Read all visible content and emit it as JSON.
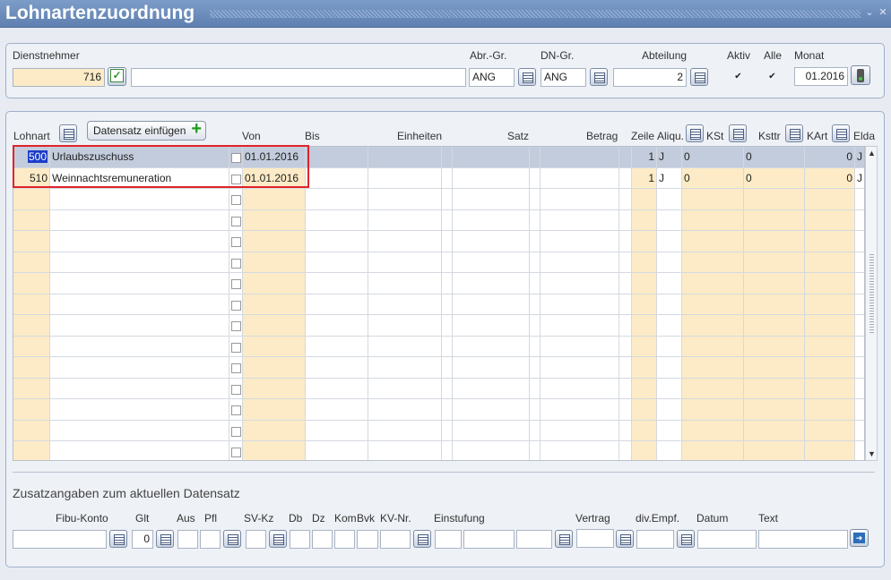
{
  "window": {
    "title": "Lohnartenzuordnung",
    "minimize_glyph": "⌄",
    "close_glyph": "✕"
  },
  "header": {
    "dienstnehmer_label": "Dienstnehmer",
    "dienstnehmer_value": "716",
    "dienstnehmer_name": "",
    "abr_gr_label": "Abr.-Gr.",
    "abr_gr_value": "ANG",
    "dn_gr_label": "DN-Gr.",
    "dn_gr_value": "ANG",
    "abteilung_label": "Abteilung",
    "abteilung_value": "2",
    "aktiv_label": "Aktiv",
    "aktiv_checked": true,
    "alle_label": "Alle",
    "alle_checked": true,
    "monat_label": "Monat",
    "monat_value": "01.2016"
  },
  "table": {
    "add_button_label": "Datensatz einfügen",
    "columns": {
      "lohnart": "Lohnart",
      "von": "Von",
      "bis": "Bis",
      "einheiten": "Einheiten",
      "satz": "Satz",
      "betrag": "Betrag",
      "zeile": "Zeile",
      "aliqu": "Aliqu.",
      "kst": "KSt",
      "ksttr": "Ksttr",
      "kart": "KArt",
      "elda": "Elda"
    },
    "rows": [
      {
        "lohnart": "500",
        "bezeichnung": "Urlaubszuschuss",
        "von": "01.01.2016",
        "zeile": "1",
        "aliqu": "J",
        "kst": "0",
        "ksttr": "0",
        "kart": "0",
        "elda": "J"
      },
      {
        "lohnart": "510",
        "bezeichnung": "Weinnachtsremuneration",
        "von": "01.01.2016",
        "zeile": "1",
        "aliqu": "J",
        "kst": "0",
        "ksttr": "0",
        "kart": "0",
        "elda": "J"
      }
    ]
  },
  "zusatz": {
    "heading": "Zusatzangaben zum aktuellen Datensatz",
    "labels": {
      "fibu_konto": "Fibu-Konto",
      "glt": "Glt",
      "aus": "Aus",
      "pfl": "Pfl",
      "sv_kz": "SV-Kz",
      "db": "Db",
      "dz": "Dz",
      "kom": "Kom",
      "bvk": "Bvk",
      "kv_nr": "KV-Nr.",
      "einstufung": "Einstufung",
      "vertrag": "Vertrag",
      "div_empf": "div.Empf.",
      "datum": "Datum",
      "text": "Text"
    },
    "glt_value": "0"
  },
  "icons": {
    "calendar": "calendar-icon",
    "accept": "check-icon",
    "add": "plus-icon",
    "go": "arrow-right-icon",
    "traffic": "traffic-light-icon"
  }
}
